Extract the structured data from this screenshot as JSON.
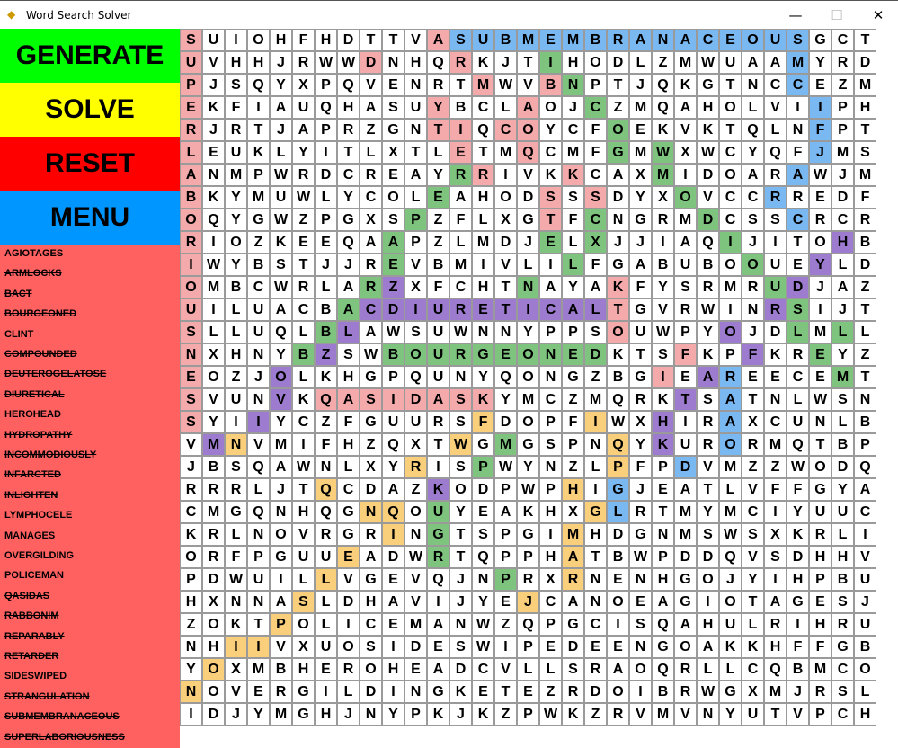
{
  "window": {
    "title": "Word Search Solver",
    "app_icon": "python-icon"
  },
  "sidebar": {
    "generate_label": "GENERATE",
    "solve_label": "SOLVE",
    "reset_label": "RESET",
    "menu_label": "MENU",
    "button_colors": {
      "generate": "#00ff00",
      "solve": "#ffff00",
      "reset": "#ff0000",
      "menu": "#0096ff"
    },
    "panel_color": "#ff6060",
    "words": [
      {
        "text": "AGIOTAGES",
        "found": false
      },
      {
        "text": "ARMLOCKS",
        "found": true
      },
      {
        "text": "BACT",
        "found": true
      },
      {
        "text": "BOURGEONED",
        "found": true
      },
      {
        "text": "CLINT",
        "found": true
      },
      {
        "text": "COMPOUNDED",
        "found": true
      },
      {
        "text": "DEUTEROGELATOSE",
        "found": true
      },
      {
        "text": "DIURETICAL",
        "found": true
      },
      {
        "text": "HEROHEAD",
        "found": false
      },
      {
        "text": "HYDROPATHY",
        "found": true
      },
      {
        "text": "INCOMMODIOUSLY",
        "found": true
      },
      {
        "text": "INFARCTED",
        "found": true
      },
      {
        "text": "INLIGHTEN",
        "found": true
      },
      {
        "text": "LYMPHOCELE",
        "found": false
      },
      {
        "text": "MANAGES",
        "found": false
      },
      {
        "text": "OVERGILDING",
        "found": false
      },
      {
        "text": "POLICEMAN",
        "found": false
      },
      {
        "text": "QASIDAS",
        "found": true
      },
      {
        "text": "RABBONIM",
        "found": true
      },
      {
        "text": "REPARABLY",
        "found": true
      },
      {
        "text": "RETARDER",
        "found": true
      },
      {
        "text": "SIDESWIPED",
        "found": false
      },
      {
        "text": "STRANGULATION",
        "found": true
      },
      {
        "text": "SUBMEMBRANACEOUS",
        "found": true
      },
      {
        "text": "SUPERLABORIOUSNESS",
        "found": true
      }
    ]
  },
  "grid": {
    "rows": [
      "SUIOHFHDTTVASUBMEMBRANACEOUSGCT",
      "UVHHJRWWDNHQRKJTIHODLZMWUAAMYRD",
      "PJSQYXPQVENRTMWVBNPTJQKGTNCCEZM",
      "EKFIAUQHASUYBCLAOJCZMQAHOLVIIPH",
      "RJRTJAPRZGNTIQCOYCFOEKVKTQLNFPT",
      "LEUKLYITLXTLETMQCMFGMWXWCYQFJMS",
      "ANMPWRDCREAYRRIVKKCAXMIDOARAWJM",
      "BKYMUWLYCOLEAHODSSSDYXOVCCRREDF",
      "OQYGWZPGXSPZFLXGTFCNGRMDCSSCRCR",
      "RIOZKEEQAAPZLMDJELXJJIAQIJITOHB",
      "IWYBSTJJREVBMIVLILFGABUBOOUEYLD",
      "OMBCWRLARZXFCHTNAYAKFYSRMRUDJAZ",
      "UILUACBACDIURETICALTGVRWINRSIJT",
      "SLLUQLBLAWSUWNNYPPSOUWPYOJDLMLL",
      "NXHNYBZSWBOURGEONEDKTSFKPFKREYZ",
      "EOZJOLKHGPQUNYQONGZBGIEAREECEMT",
      "SVUNVKQASIDASKYMCZMQRKTSATNLWSN",
      "SYIIYCZFGUURSFDOPFIWXHIRAXCUNLB",
      "VMNVMIFHZQXTWGMGSPNQYKURORMQTBP",
      "JBSQAWNLXYRISPWYNZLPFPDVMZZWODQ",
      "RRRLJTQCDAZKODPWPHIGJEATLVFFGYA",
      "CMGQNHQGNQOUYEAKHXGLRTMYMCIYUUC",
      "KRLNOVRGRINGTSPGIMHDGNMSWSXKRLI",
      "ORFPGUUEADWRTQPPHATBWPDDQVSDHHV",
      "PDWUILLVGEVQJNPRXRNENHGOJYIHPBUM",
      "HXNNASLDHAVIJYEJCANOEAGIOTAGESJ",
      "ZOKTPOLICEMANWZQPGCISQAHULRIHRU",
      "NHIIVXUOSIDESWIPEDEENGOAKKHFFGBF",
      "YOXMBHEROHEADCVLLSRAOQRLLCQBMCO",
      "NOVERGILDINGKETEZRDOIBRWGXMJRSL",
      "IDJYMGHJNYPKJKZPWKZRVMVNYUTVPCH"
    ],
    "highlight_colors": {
      "p": "#f4aaaa",
      "b": "#7ab8f2",
      "g": "#7ec47e",
      "v": "#9d7ccf",
      "y": "#f9cf7c"
    },
    "highlights": [
      "p..........pbbbbbbbbbbbbbbbb...",
      "p.......p...p...g..........b...",
      "p............p..pg.........b...",
      "p..........p...p..g.........b..",
      "p..........pp.pp...g........b..",
      "p...........p..p...g.g......b..",
      "p...........gp...p...g.....b...",
      "p..........g....p.p...g...b....",
      "p.........g.....p.g....g...b...",
      "p........g......g.g.....g....v.",
      "p........g.......g.......g..v..",
      "p.......gv.....g...p......gv...",
      "p......gvvvvvvvvvvvp......vg...",
      "p.....gv...........p....v..g.g.",
      "p....gv..gggggggggg...p..v..g..",
      "p...v................p.vb....g.",
      "p...v.pppppppp........v.b......",
      "p..v.........y....y..v..b......",
      ".vy.........y.g....y.v..b......",
      "..........y..g.....y..b.......",
      "......y....v.....y.b.........",
      "........yy.g......yb..........",
      ".........y.g.....y.............",
      ".......y...g.....y.............",
      "......y.......g..y.............",
      ".....y.........y...............",
      "....y..........................",
      "..yy...........................",
      ".y.............................",
      "y..............................",
      "..............................."
    ]
  }
}
